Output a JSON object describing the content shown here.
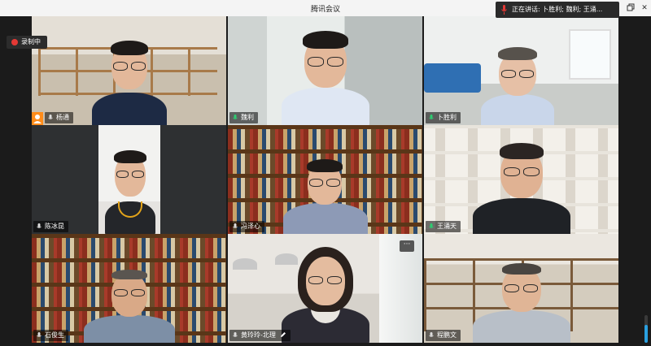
{
  "window": {
    "title": "腾讯会议"
  },
  "recording": {
    "label": "录制中",
    "color": "#e53935"
  },
  "speaking": {
    "text": "正在讲话:  卜胜利; 魏利; 王涌..."
  },
  "participants": [
    {
      "name": "杨通",
      "host_icon": true
    },
    {
      "name": "魏利"
    },
    {
      "name": "卜胜利"
    },
    {
      "name": "陈冰昆"
    },
    {
      "name": "冯泽心"
    },
    {
      "name": "王涌天"
    },
    {
      "name": "石俊生"
    },
    {
      "name": "黄玲玲-北理",
      "edit_icon": true,
      "more": "···"
    },
    {
      "name": "程鹏文"
    }
  ],
  "colors": {
    "accent_green": "#2ecc71",
    "mic_gray": "#dddddd",
    "host_orange": "#ff8c1a"
  }
}
